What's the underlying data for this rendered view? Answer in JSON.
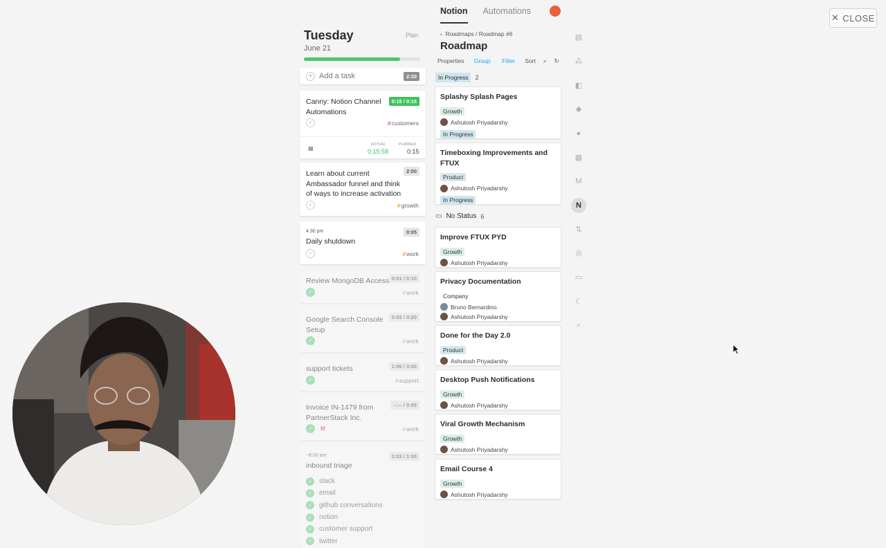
{
  "close_button": {
    "icon": "x-icon",
    "label": "CLOSE"
  },
  "day": {
    "title": "Tuesday",
    "date": "June 21",
    "plan_label": "Plan",
    "progress_fraction": 0.83,
    "add_task": {
      "label": "Add a task",
      "time": "2:20"
    },
    "tasks": [
      {
        "title": "Canny: Notion Channel Automations",
        "time": "0:15 / 0:15",
        "tag": "customers",
        "tag_color": "#e0528a",
        "actual_label": "ACTUAL",
        "actual_value": "0:15:58",
        "planned_label": "PLANNED",
        "planned_value": "0:15"
      },
      {
        "title": "Learn about current Ambassador funnel and think of ways to increase activation",
        "time": "2:00",
        "tag": "growth",
        "tag_color": "#e8a23a"
      },
      {
        "pre": "4:30 pm",
        "title": "Daily shutdown",
        "time": "0:05",
        "tag": "work",
        "tag_color": "#e8a23a"
      },
      {
        "title": "Review MongoDB Access",
        "time": "0:01 / 0:10",
        "tag": "work",
        "tag_color": "#e8a23a"
      },
      {
        "title": "Google Search Console Setup",
        "time": "0:02 / 0:20",
        "tag": "work",
        "tag_color": "#e8a23a"
      },
      {
        "title": "support tickets",
        "time": "1:06 / 3:00",
        "tag": "support",
        "tag_color": "#b98fe0"
      },
      {
        "title": "Invoice IN-1479 from PartnerStack Inc.",
        "time": "--:-- / 0:05",
        "tag": "work",
        "tag_color": "#e8a23a",
        "source_icon": "gmail-icon"
      },
      {
        "pre": "~8:00 am",
        "title": "inbound triage",
        "time": "1:03 / 1:00",
        "subtasks": [
          "slack",
          "email",
          "github conversations",
          "notion",
          "customer support",
          "twitter"
        ]
      }
    ]
  },
  "tabs": [
    {
      "label": "Notion",
      "active": true
    },
    {
      "label": "Automations",
      "active": false
    }
  ],
  "notion": {
    "breadcrumb": "Roadmaps / Roadmap #6",
    "title": "Roadmap",
    "toolbar": {
      "properties": "Properties",
      "group": "Group",
      "filter": "Filter",
      "sort": "Sort"
    },
    "groups": [
      {
        "name": "In Progress",
        "count": "2"
      },
      {
        "name": "No Status",
        "count": "6"
      }
    ],
    "cards": [
      {
        "title": "Splashy Splash Pages",
        "tag": "Growth",
        "people": [
          "Ashutosh Priyadarshy"
        ],
        "status": "In Progress"
      },
      {
        "title": "Timeboxing Improvements and FTUX",
        "tag": "Product",
        "people": [
          "Ashutosh Priyadarshy"
        ],
        "status": "In Progress"
      },
      {
        "title": "Improve FTUX PYD",
        "tag": "Growth",
        "people": [
          "Ashutosh Priyadarshy"
        ]
      },
      {
        "title": "Privacy Documentation",
        "tag": "Company",
        "people": [
          "Bruno Bernardino",
          "Ashutosh Priyadarshy"
        ]
      },
      {
        "title": "Done for the Day 2.0",
        "tag": "Product",
        "people": [
          "Ashutosh Priyadarshy"
        ]
      },
      {
        "title": "Desktop Push Notifications",
        "tag": "Growth",
        "people": [
          "Ashutosh Priyadarshy"
        ]
      },
      {
        "title": "Viral Growth Mechanism",
        "tag": "Growth",
        "people": [
          "Ashutosh Priyadarshy"
        ]
      },
      {
        "title": "Email Course 4",
        "tag": "Growth",
        "people": [
          "Ashutosh Priyadarshy"
        ]
      }
    ]
  },
  "rail_icons": [
    "calendar-icon",
    "people-icon",
    "trello-icon",
    "diamond-icon",
    "github-icon",
    "sheet-icon",
    "gmail-icon",
    "notion-icon",
    "sync-icon",
    "target-icon",
    "archive-icon",
    "moon-icon",
    "search-icon"
  ],
  "colors": {
    "accent_green": "#3ec25b",
    "progress_green": "#4cc86a",
    "filter_blue": "#3a9fd8",
    "orange_avatar": "#e9603a"
  }
}
